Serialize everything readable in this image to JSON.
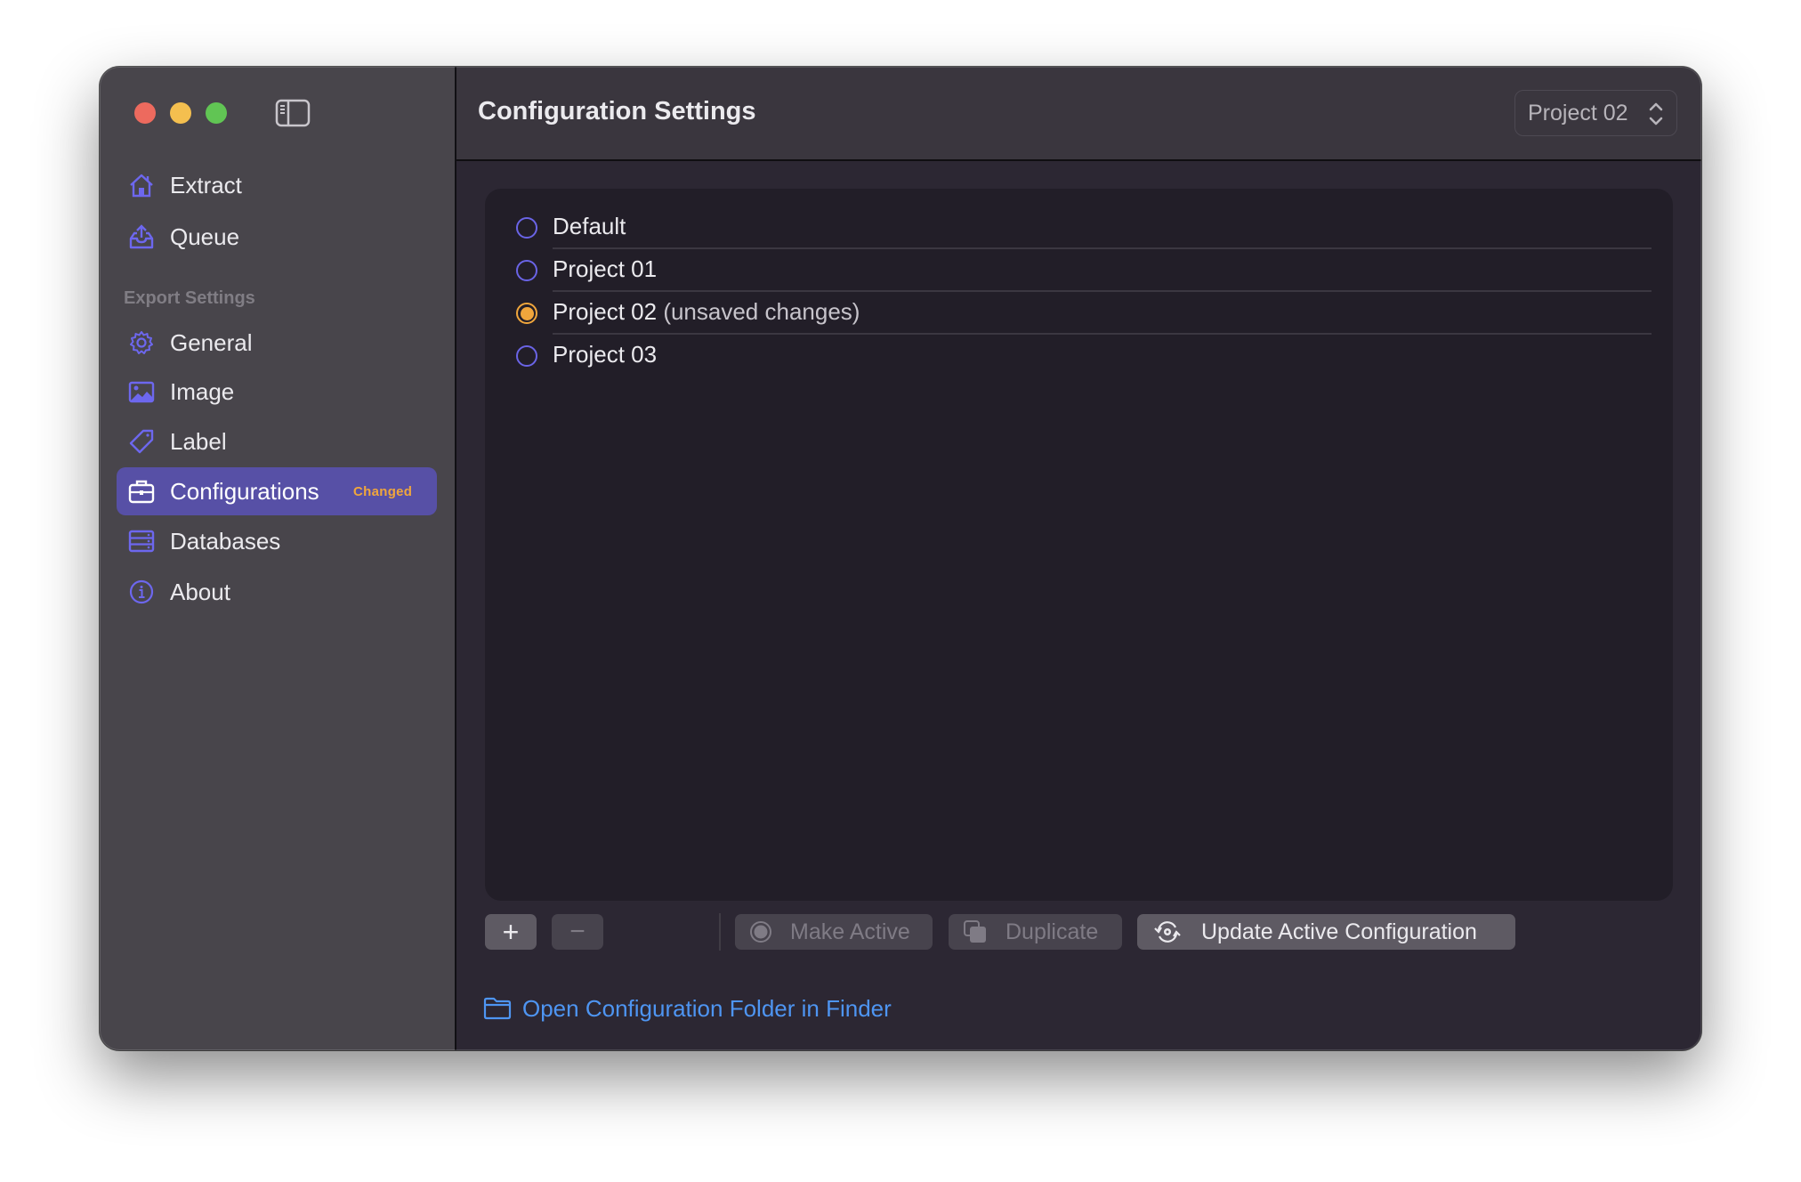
{
  "window": {
    "traffic_lights": [
      "close",
      "minimize",
      "zoom"
    ]
  },
  "sidebar": {
    "top_items": [
      {
        "label": "Extract",
        "icon": "house-icon"
      },
      {
        "label": "Queue",
        "icon": "tray-upload-icon"
      }
    ],
    "section_label": "Export Settings",
    "items": [
      {
        "label": "General",
        "icon": "gear-icon"
      },
      {
        "label": "Image",
        "icon": "photo-icon"
      },
      {
        "label": "Label",
        "icon": "tag-icon"
      },
      {
        "label": "Configurations",
        "icon": "briefcase-icon",
        "active": true,
        "badge": "Changed"
      },
      {
        "label": "Databases",
        "icon": "server-rack-icon"
      },
      {
        "label": "About",
        "icon": "info-circle-icon"
      }
    ]
  },
  "header": {
    "title": "Configuration Settings",
    "picker_value": "Project 02"
  },
  "configurations": [
    {
      "name": "Default",
      "note": "",
      "selected": false
    },
    {
      "name": "Project 01",
      "note": "",
      "selected": false
    },
    {
      "name": "Project 02",
      "note": "(unsaved changes)",
      "selected": true
    },
    {
      "name": "Project 03",
      "note": "",
      "selected": false
    }
  ],
  "toolbar": {
    "add_label": "+",
    "remove_label": "−",
    "make_active_label": "Make Active",
    "duplicate_label": "Duplicate",
    "update_label": "Update Active Configuration"
  },
  "footer": {
    "folder_link": "Open Configuration Folder in Finder",
    "help_label": "?"
  },
  "colors": {
    "accent": "#5750a6",
    "radio": "#6a64e6",
    "changed": "#f0a63c",
    "link": "#4e95f2"
  }
}
